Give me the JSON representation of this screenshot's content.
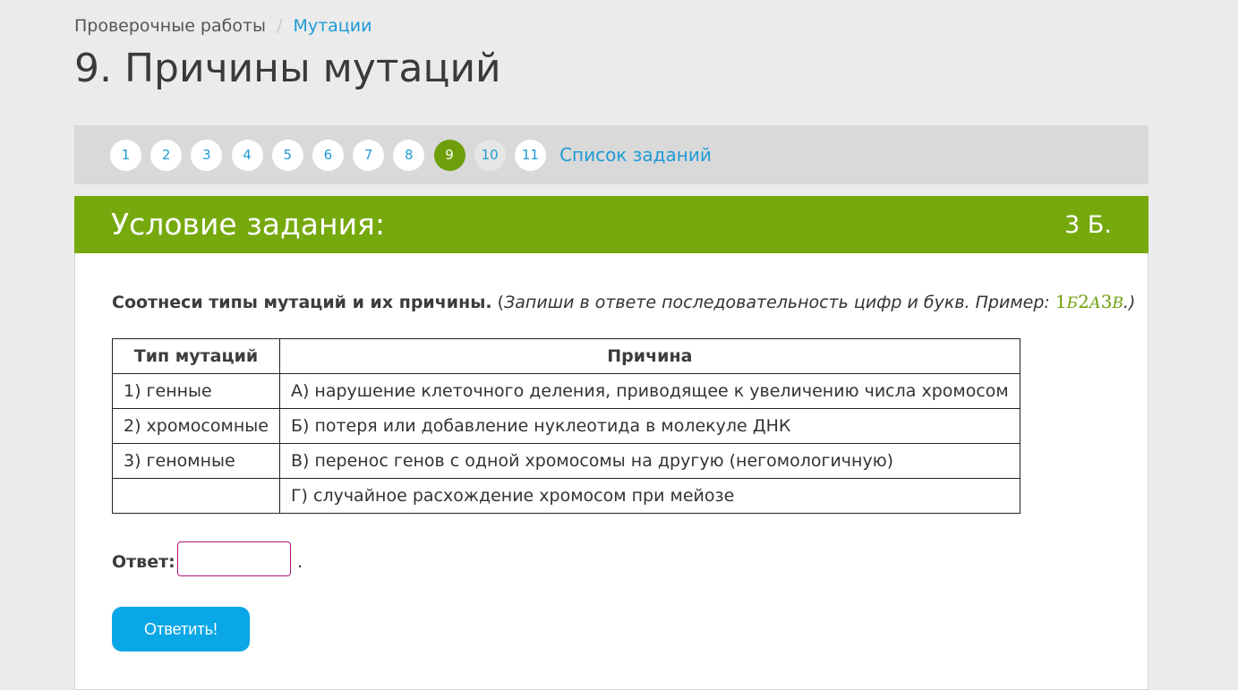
{
  "breadcrumb": {
    "parent": "Проверочные работы",
    "separator": "/",
    "current": "Мутации"
  },
  "page_title": "9. Причины мутаций",
  "task_nav": {
    "items": [
      "1",
      "2",
      "3",
      "4",
      "5",
      "6",
      "7",
      "8",
      "9",
      "10",
      "11"
    ],
    "active": "9",
    "list_link": "Список заданий"
  },
  "card": {
    "header_title": "Условие задания:",
    "points": "3 Б.",
    "question_bold": "Соотнеси типы мутаций и их причины.",
    "question_open": "(",
    "question_italic": "Запиши в ответе последовательность цифр и букв. Пример: ",
    "example": [
      "1",
      "Б",
      "2",
      "А",
      "3",
      "В"
    ],
    "question_close": ".)",
    "table": {
      "headers": [
        "Тип мутаций",
        "Причина"
      ],
      "rows": [
        [
          "1) генные",
          "А) нарушение клеточного деления, приводящее к увеличению числа хромосом"
        ],
        [
          "2) хромосомные",
          "Б) потеря или добавление нуклеотида в молекуле ДНК"
        ],
        [
          "3) геномные",
          "В) перенос генов с одной хромосомы на другую (негомологичную)"
        ],
        [
          "",
          "Г) случайное расхождение хромосом при мейозе"
        ]
      ]
    },
    "answer_label": "Ответ:",
    "answer_value": "",
    "answer_suffix": ".",
    "submit_label": "Ответить!"
  },
  "colors": {
    "accent_green": "#76a90e",
    "link_blue": "#1f9ad6",
    "button_blue": "#0aa7e6",
    "input_border": "#b0157a"
  }
}
